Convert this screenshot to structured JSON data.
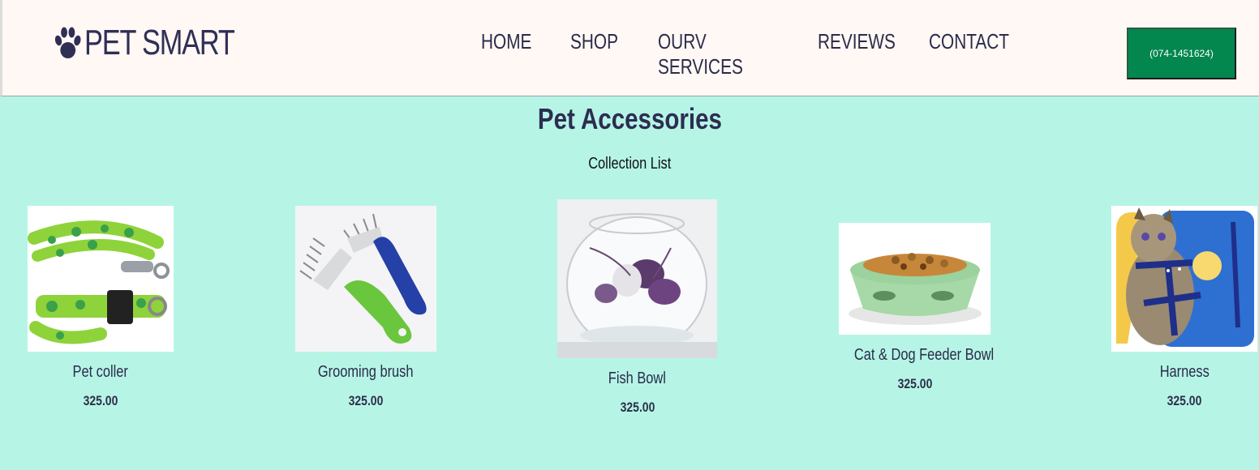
{
  "header": {
    "logo_text": "PET SMART",
    "nav": [
      "HOME",
      "SHOP",
      "OURV SERVICES",
      "REVIEWS",
      "CONTACT"
    ],
    "phone_button": "(074-1451624)"
  },
  "section": {
    "title": "Pet Accessories",
    "subtitle": "Collection List"
  },
  "products": [
    {
      "name": "Pet coller",
      "price": "325.00",
      "image": "green-leash-collar"
    },
    {
      "name": "Grooming brush",
      "price": "325.00",
      "image": "grooming-brush"
    },
    {
      "name": "Fish Bowl",
      "price": "325.00",
      "image": "glass-fish-bowl"
    },
    {
      "name": "Cat & Dog Feeder Bowl",
      "price": "325.00",
      "image": "green-feeder-bowl"
    },
    {
      "name": "Harness",
      "price": "325.00",
      "image": "cat-harness"
    }
  ],
  "colors": {
    "page_bg": "#b6f5e6",
    "header_bg": "#fff8f4",
    "button_bg": "#03874f",
    "text": "#2b2b4a"
  }
}
